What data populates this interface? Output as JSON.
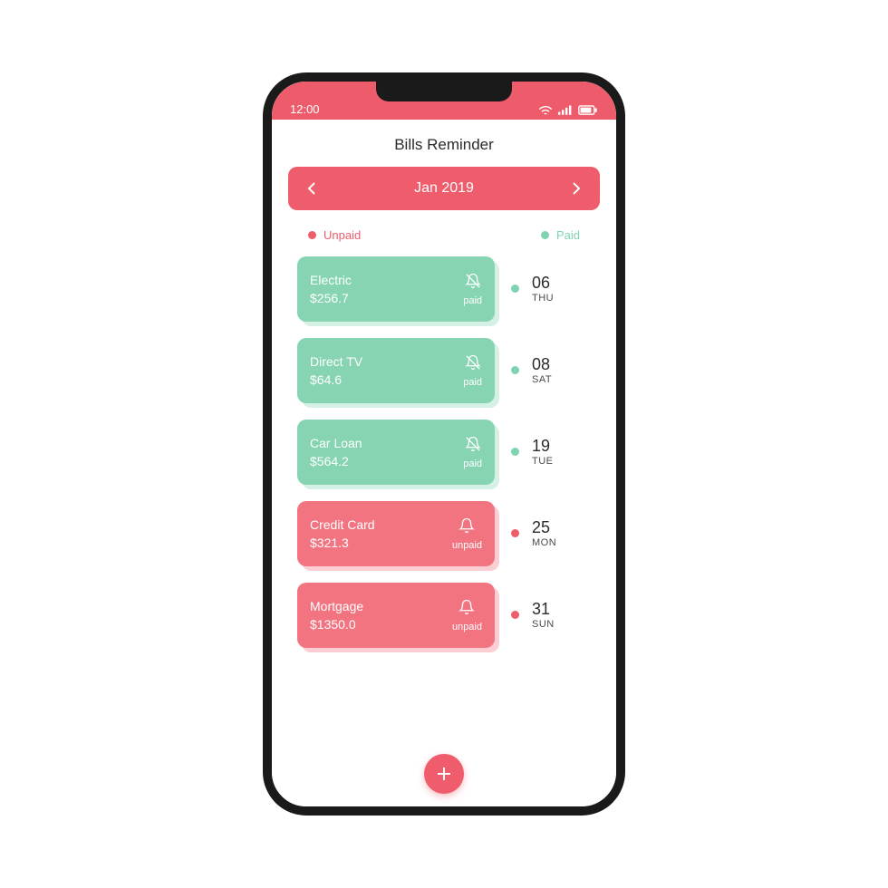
{
  "status": {
    "time": "12:00"
  },
  "header": {
    "title": "Bills Reminder"
  },
  "picker": {
    "month": "Jan 2019"
  },
  "legend": {
    "unpaid": "Unpaid",
    "paid": "Paid"
  },
  "colors": {
    "accent": "#ef5c6b",
    "paid": "#86d4b2",
    "unpaid": "#f27480"
  },
  "bills": [
    {
      "name": "Electric",
      "amount": "$256.7",
      "status": "paid",
      "day": "06",
      "weekday": "THU"
    },
    {
      "name": "Direct TV",
      "amount": "$64.6",
      "status": "paid",
      "day": "08",
      "weekday": "SAT"
    },
    {
      "name": "Car Loan",
      "amount": "$564.2",
      "status": "paid",
      "day": "19",
      "weekday": "TUE"
    },
    {
      "name": "Credit Card",
      "amount": "$321.3",
      "status": "unpaid",
      "day": "25",
      "weekday": "MON"
    },
    {
      "name": "Mortgage",
      "amount": "$1350.0",
      "status": "unpaid",
      "day": "31",
      "weekday": "SUN"
    }
  ]
}
